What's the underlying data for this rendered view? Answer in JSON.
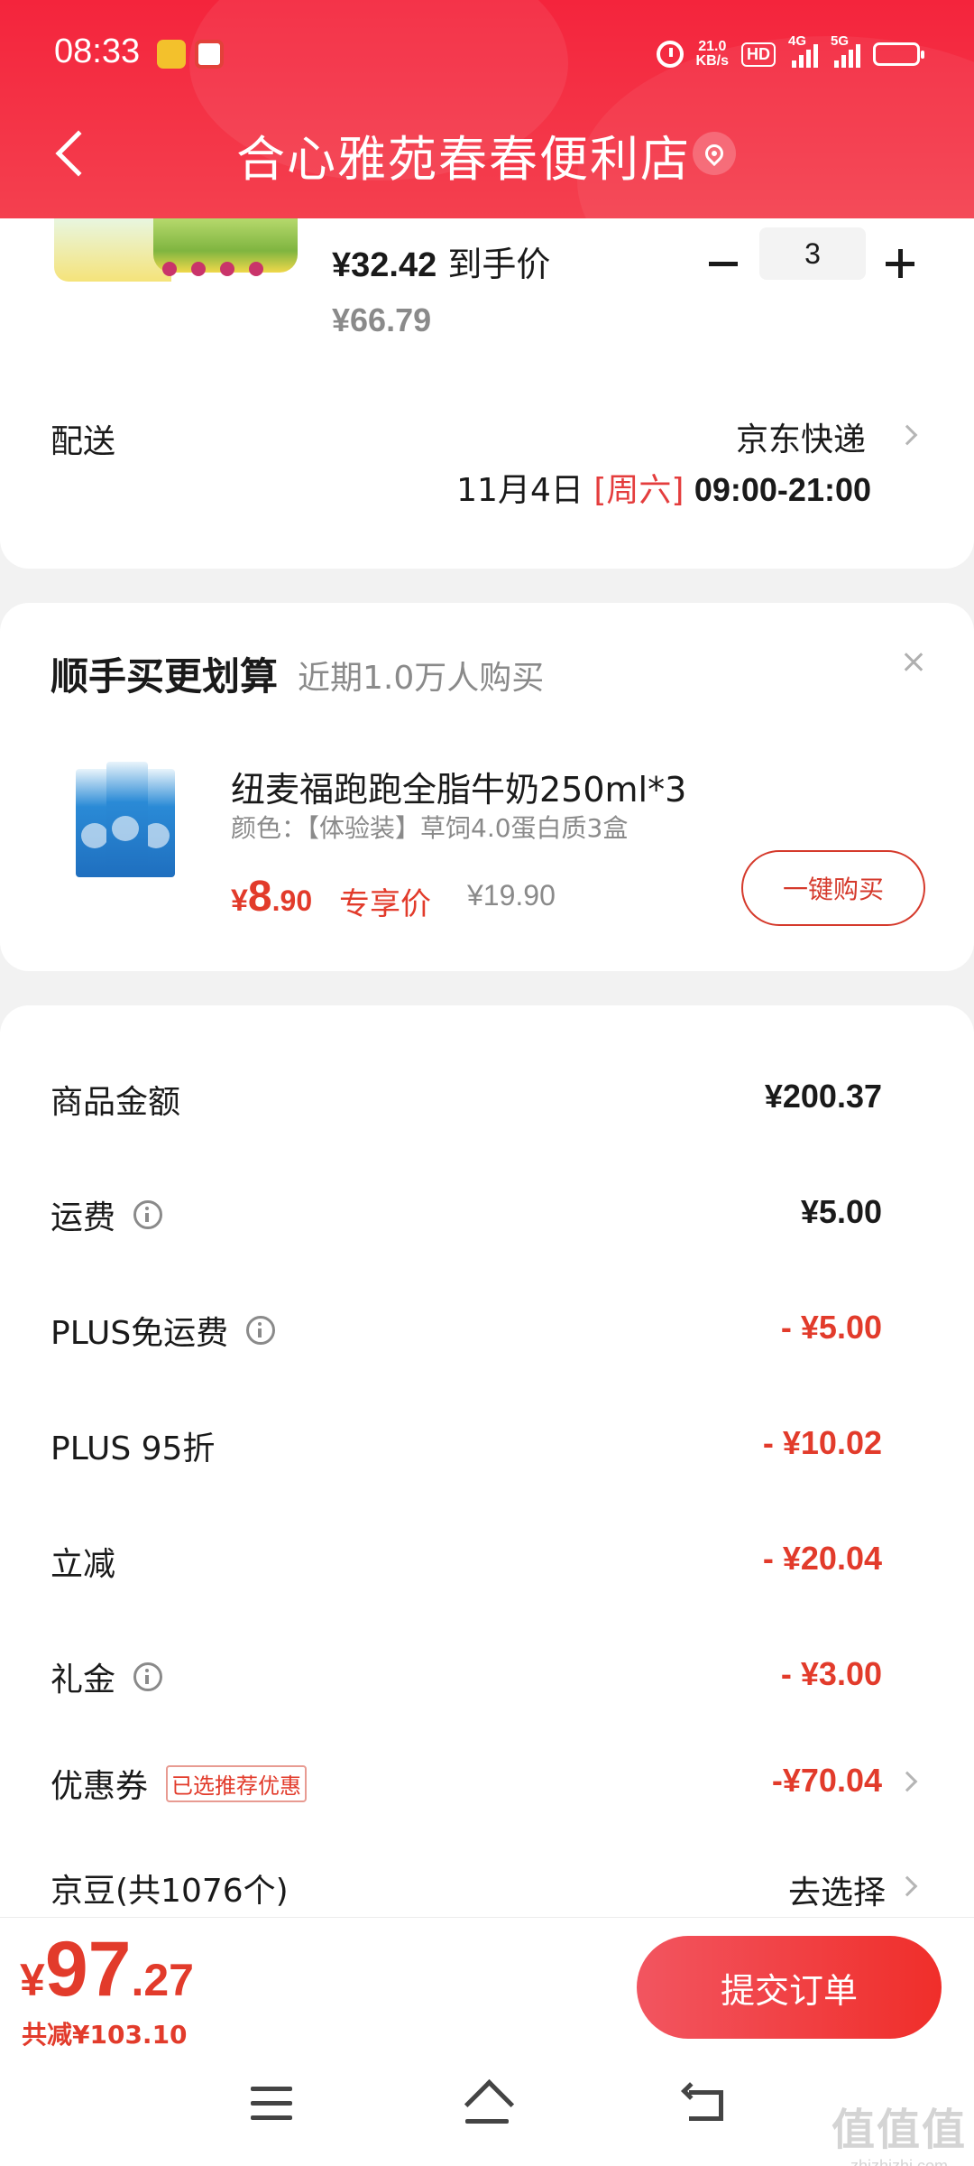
{
  "status_bar": {
    "time": "08:33",
    "net_speed_top": "21.0",
    "net_speed_bottom": "KB/s",
    "hd": "HD",
    "sig1": "4G",
    "sig2": "5G"
  },
  "header": {
    "title": "合心雅苑春春便利店",
    "back_icon": "chevron-left-icon",
    "location_icon": "location-pin-icon"
  },
  "product": {
    "hand_price": "¥32.42",
    "hand_price_label": "到手价",
    "original_price": "¥66.79",
    "quantity": "3"
  },
  "shipping": {
    "label": "配送",
    "method": "京东快递",
    "date": "11月4日",
    "weekday": "[周六]",
    "time": "09:00-21:00"
  },
  "recommend": {
    "title": "顺手买更划算",
    "subtitle": "近期1.0万人购买",
    "product_name": "纽麦福跑跑全脂牛奶250ml*3",
    "product_spec": "颜色：【体验装】草饲4.0蛋白质3盒",
    "price_symbol": "¥",
    "price_int": "8",
    "price_dec": ".90",
    "price_tag": "专享价",
    "old_price": "¥19.90",
    "buy_button": "一键购买"
  },
  "summary": {
    "goods_label": "商品金额",
    "goods_value": "¥200.37",
    "freight_label": "运费",
    "freight_value": "¥5.00",
    "plus_free_label": "PLUS免运费",
    "plus_free_value": "- ¥5.00",
    "plus_disc_label": "PLUS 95折",
    "plus_disc_value": "- ¥10.02",
    "instant_label": "立减",
    "instant_value": "- ¥20.04",
    "gift_label": "礼金",
    "gift_value": "- ¥3.00",
    "coupon_label": "优惠券",
    "coupon_badge": "已选推荐优惠",
    "coupon_value": "-¥70.04",
    "jd_bean_label": "京豆(共1076个)",
    "jd_bean_value": "去选择"
  },
  "bottom": {
    "price_symbol": "¥",
    "price_int": "97",
    "price_dec": ".27",
    "total_save": "共减¥103.10",
    "submit": "提交订单"
  },
  "watermark": {
    "big": "值值值",
    "small": "zhizhizhi.com"
  },
  "colors": {
    "brand_red": "#f4243c",
    "price_red": "#e23b2b"
  }
}
